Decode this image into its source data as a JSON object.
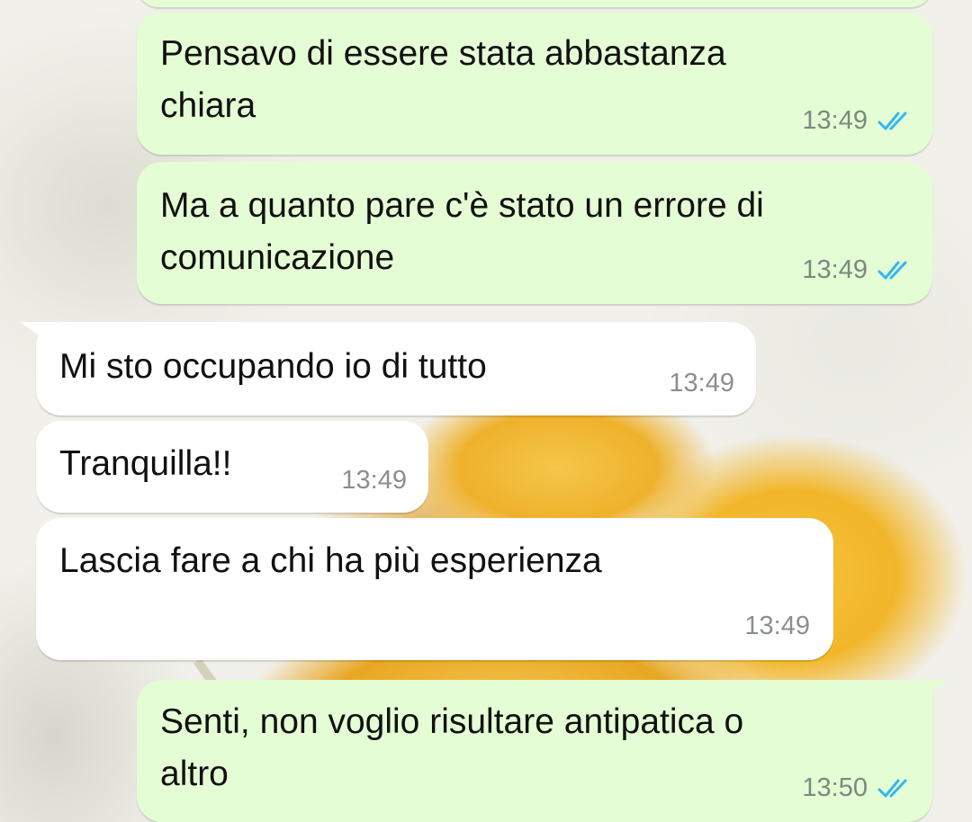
{
  "messages": [
    {
      "text": "Pensavo di essere stata abbastanza\nchiara",
      "time": "13:49",
      "direction": "outgoing",
      "status": "read"
    },
    {
      "text": "Ma a quanto pare c'è stato un errore di\ncomunicazione",
      "time": "13:49",
      "direction": "outgoing",
      "status": "read"
    },
    {
      "text": "Mi sto occupando io di tutto",
      "time": "13:49",
      "direction": "incoming"
    },
    {
      "text": "Tranquilla!!",
      "time": "13:49",
      "direction": "incoming"
    },
    {
      "text": "Lascia fare a chi ha più esperienza",
      "time": "13:49",
      "direction": "incoming"
    },
    {
      "text": "Senti, non voglio risultare antipatica o\naltro",
      "time": "13:50",
      "direction": "outgoing",
      "status": "read"
    }
  ],
  "colors": {
    "outgoing_bubble": "#e5fdd5",
    "incoming_bubble": "#ffffff",
    "read_ticks": "#34b7f1",
    "timestamp": "#7b8a7e"
  },
  "icons": {
    "read_receipt": "double-check-icon"
  }
}
